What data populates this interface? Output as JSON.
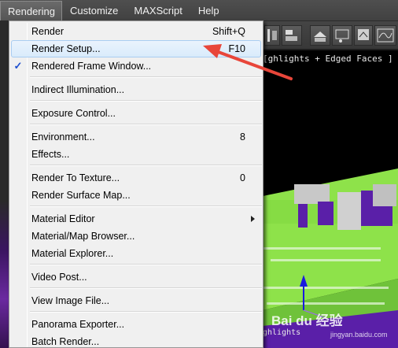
{
  "menubar": {
    "items": [
      {
        "label": "Rendering",
        "open": true
      },
      {
        "label": "Customize"
      },
      {
        "label": "MAXScript"
      },
      {
        "label": "Help"
      }
    ]
  },
  "viewport": {
    "label_top": "[ghlights + Edged Faces ]",
    "label_bottom": "ghlights"
  },
  "dropdown": {
    "items": [
      {
        "label": "Render",
        "shortcut": "Shift+Q"
      },
      {
        "label": "Render Setup...",
        "shortcut": "F10",
        "highlighted": true
      },
      {
        "label": "Rendered Frame Window...",
        "checked": true
      },
      {
        "label": "Indirect Illumination..."
      },
      {
        "label": "Exposure Control..."
      },
      {
        "label": "Environment...",
        "shortcut": "8"
      },
      {
        "label": "Effects..."
      },
      {
        "label": "Render To Texture...",
        "shortcut": "0"
      },
      {
        "label": "Render Surface Map..."
      },
      {
        "label": "Material Editor",
        "submenu": true
      },
      {
        "label": "Material/Map Browser..."
      },
      {
        "label": "Material Explorer..."
      },
      {
        "label": "Video Post..."
      },
      {
        "label": "View Image File..."
      },
      {
        "label": "Panorama Exporter..."
      },
      {
        "label": "Batch Render..."
      }
    ],
    "check_glyph": "✓"
  },
  "annotation": {
    "arrow_color": "#e8463a"
  },
  "watermark": {
    "text": "Bai du 经验",
    "url": "jingyan.baidu.com"
  },
  "colors": {
    "menubar_bg": "#474747",
    "viewport_green": "#8ee24a",
    "viewport_purple": "#5a1fa8",
    "highlight_border": "#a9cdf2"
  }
}
